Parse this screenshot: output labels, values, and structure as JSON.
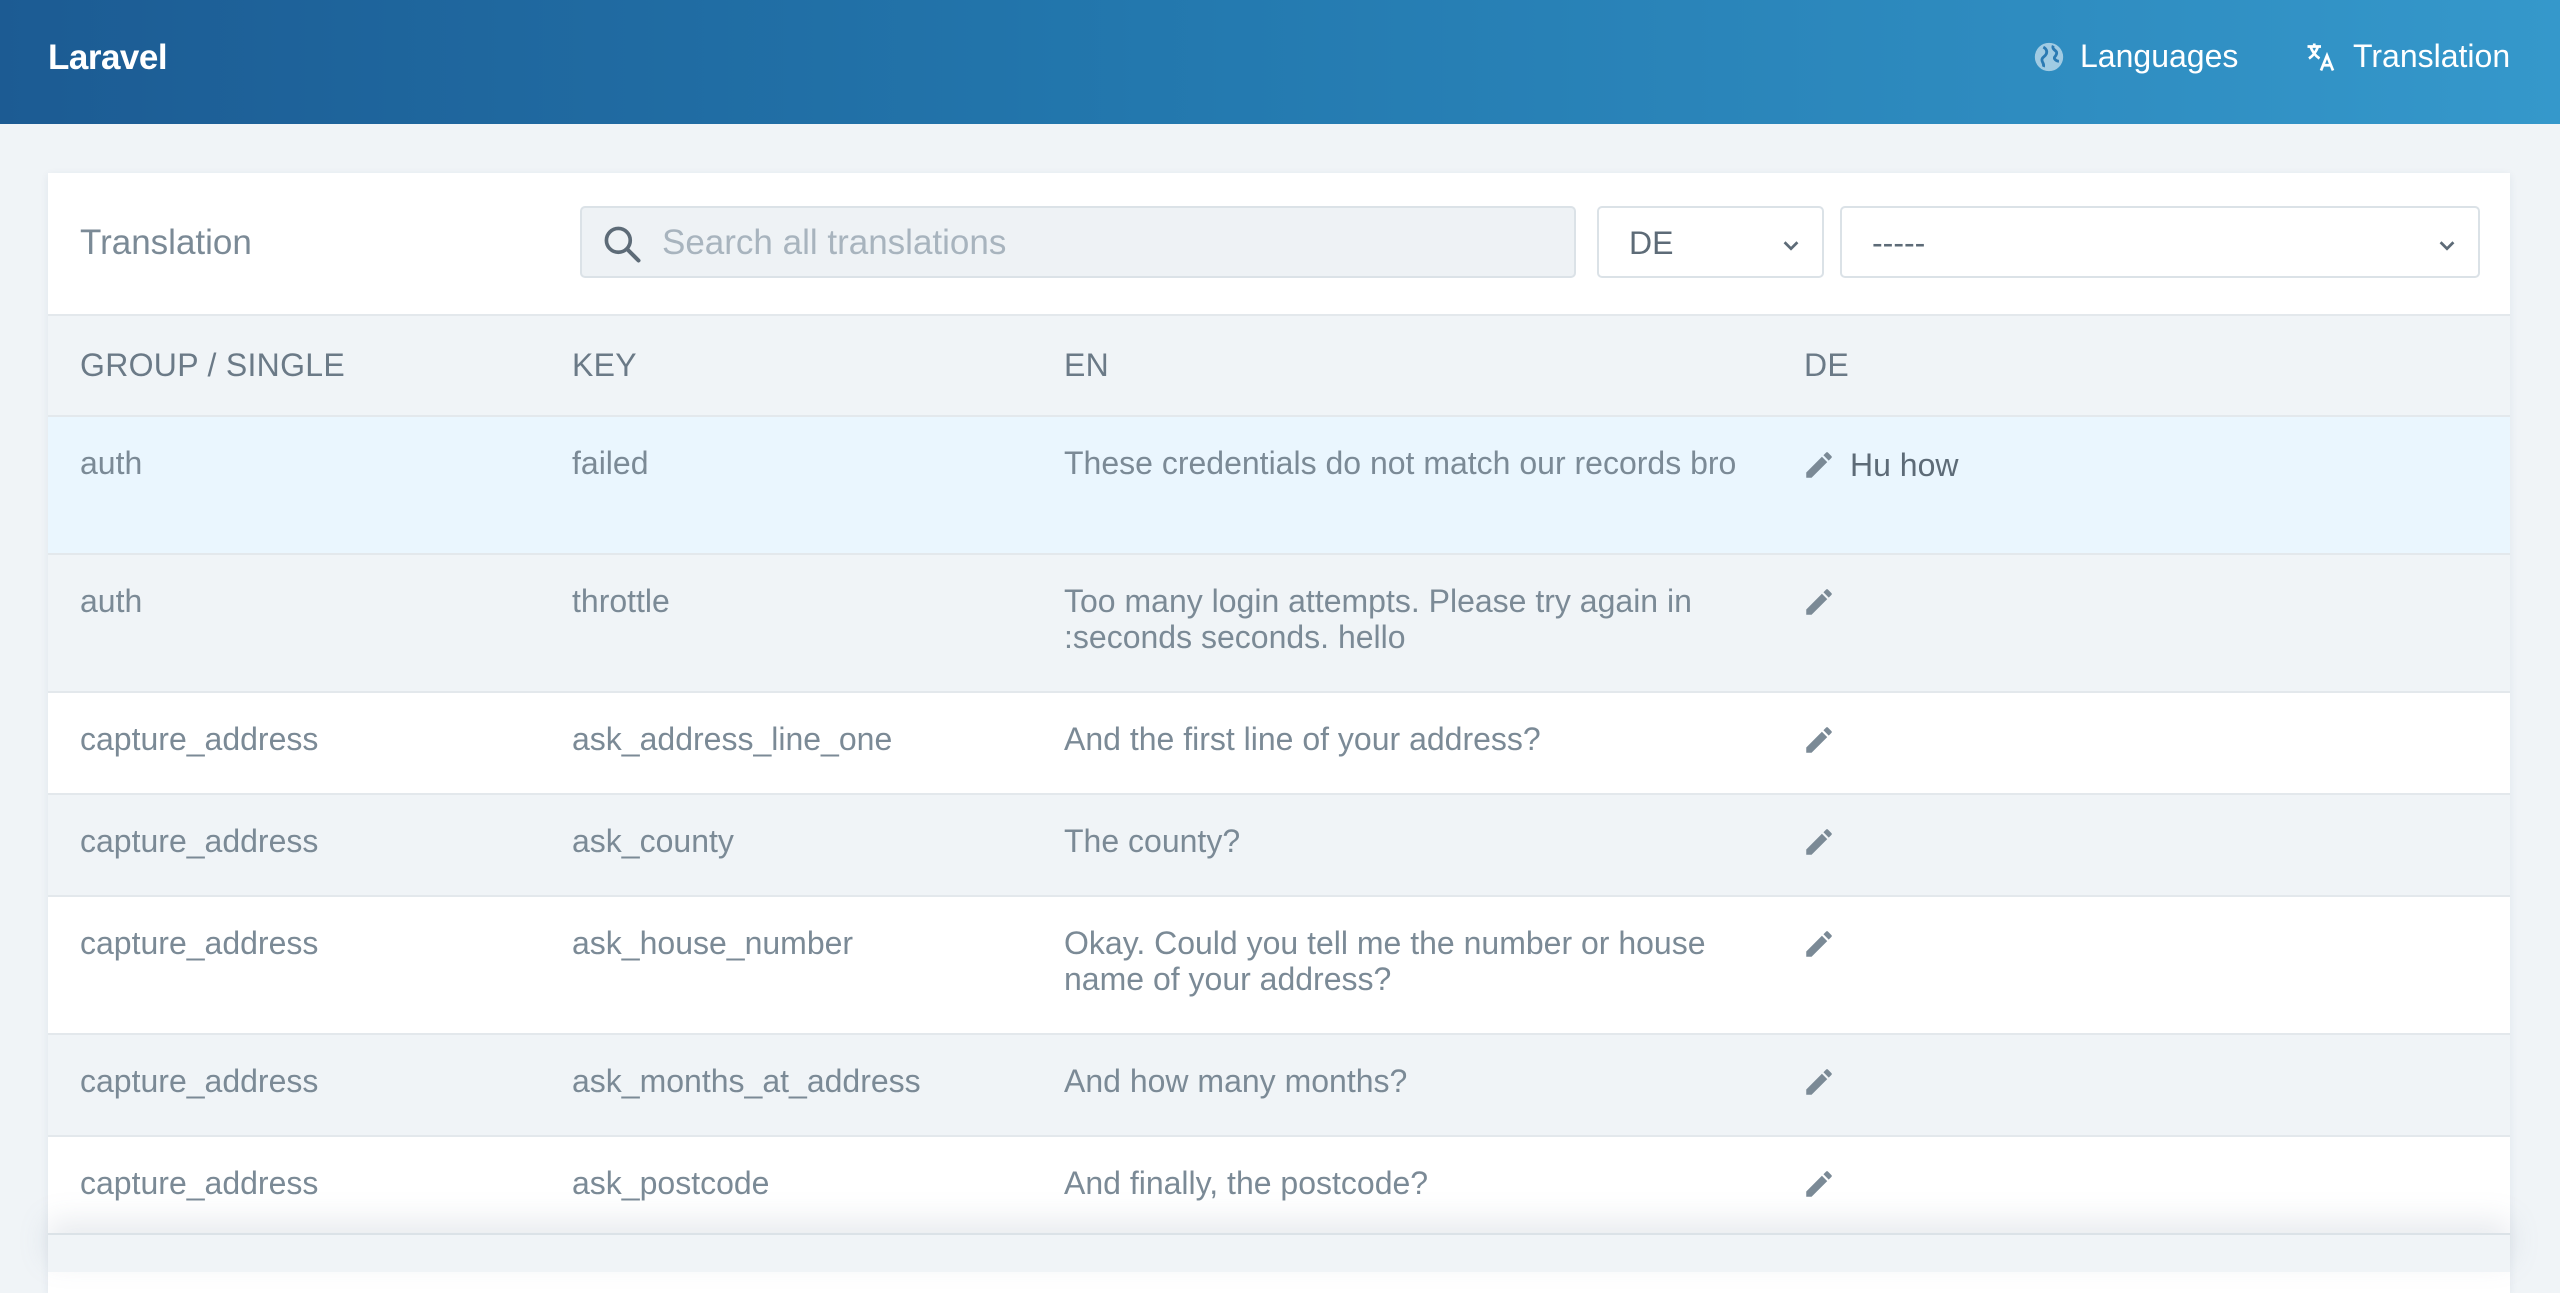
{
  "brand": "Laravel",
  "nav": {
    "languages": "Languages",
    "translation": "Translation"
  },
  "card": {
    "title": "Translation",
    "search_placeholder": "Search all translations",
    "search_value": "",
    "language_select": "DE",
    "group_select": "-----"
  },
  "table": {
    "headers": [
      "GROUP / SINGLE",
      "KEY",
      "EN",
      "DE"
    ],
    "rows": [
      {
        "group": "auth",
        "key": "failed",
        "en": "These credentials do not match our records bro",
        "de": "Hu how"
      },
      {
        "group": "auth",
        "key": "throttle",
        "en": "Too many login attempts. Please try again in :seconds seconds. hello",
        "de": ""
      },
      {
        "group": "capture_address",
        "key": "ask_address_line_one",
        "en": "And the first line of your address?",
        "de": ""
      },
      {
        "group": "capture_address",
        "key": "ask_county",
        "en": "The county?",
        "de": ""
      },
      {
        "group": "capture_address",
        "key": "ask_house_number",
        "en": "Okay. Could you tell me the number or house name of your address?",
        "de": ""
      },
      {
        "group": "capture_address",
        "key": "ask_months_at_address",
        "en": "And how many months?",
        "de": ""
      },
      {
        "group": "capture_address",
        "key": "ask_postcode",
        "en": "And finally, the postcode?",
        "de": ""
      }
    ]
  },
  "colors": {
    "header_gradient_start": "#1c5b93",
    "header_gradient_end": "#3598cb",
    "page_background": "#f0f4f7",
    "active_row": "#eaf6fe",
    "text_muted": "#7b8a96"
  },
  "icons": {
    "languages": "globe-icon",
    "translation": "translate-icon",
    "search": "search-icon",
    "edit": "pencil-icon",
    "dropdown": "chevron-down-icon"
  }
}
